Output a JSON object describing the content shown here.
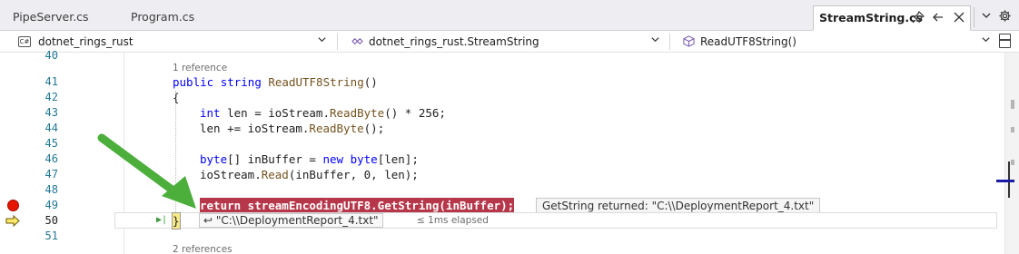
{
  "tabs": {
    "items": [
      {
        "label": "PipeServer.cs"
      },
      {
        "label": "Program.cs"
      },
      {
        "label": "StreamString.cs"
      }
    ],
    "pin_icon": "pin-icon",
    "back_icon": "undo-arrow-icon",
    "close_icon": "close-icon",
    "overflow_icon": "chevron-down-icon",
    "settings_icon": "gear-icon"
  },
  "navbar": {
    "project": "dotnet_rings_rust",
    "project_icon": "csharp-project-icon",
    "type": "dotnet_rings_rust.StreamString",
    "type_icon": "class-icon",
    "member": "ReadUTF8String()",
    "member_icon": "method-cube-icon",
    "chevron": "⌄",
    "split_icon": "split-editor-icon"
  },
  "editor": {
    "lines": [
      {
        "n": "40"
      },
      {
        "lens": "1 reference"
      },
      {
        "n": "41"
      },
      {
        "n": "42"
      },
      {
        "n": "43"
      },
      {
        "n": "44"
      },
      {
        "n": "45"
      },
      {
        "n": "46"
      },
      {
        "n": "47"
      },
      {
        "n": "48"
      },
      {
        "n": "49"
      },
      {
        "n": "50"
      },
      {
        "n": "51"
      },
      {
        "lens": "2 references"
      }
    ],
    "code": {
      "l41_kw1": "public",
      "l41_kw2": "string",
      "l41_name": "ReadUTF8String",
      "l41_rest": "()",
      "l42": "{",
      "l43_kw": "int",
      "l43_a": " len = ioStream.",
      "l43_me": "ReadByte",
      "l43_b": "() * 256;",
      "l44_a": "len += ioStream.",
      "l44_me": "ReadByte",
      "l44_b": "();",
      "l46_kw": "byte",
      "l46_a": "[] inBuffer = ",
      "l46_kw2": "new",
      "l46_kw3": "byte",
      "l46_b": "[len];",
      "l47_a": "ioStream.",
      "l47_me": "Read",
      "l47_b": "(inBuffer, 0, len);",
      "l49": "return streamEncodingUTF8.GetString(inBuffer);",
      "l50": "}"
    },
    "datatip": "GetString returned: \"C:\\\\DeploymentReport_4.txt\"",
    "return_value": "↩ \"C:\\\\DeploymentReport_4.txt\"",
    "elapsed": "≤ 1ms elapsed",
    "run_controls": "▶|"
  },
  "colors": {
    "breakpoint": "#e51400",
    "current_statement": "#b7374a",
    "keyword": "#0000ff",
    "type": "#2b91af",
    "line_number": "#237893",
    "annotation_arrow": "#4caf3c"
  }
}
